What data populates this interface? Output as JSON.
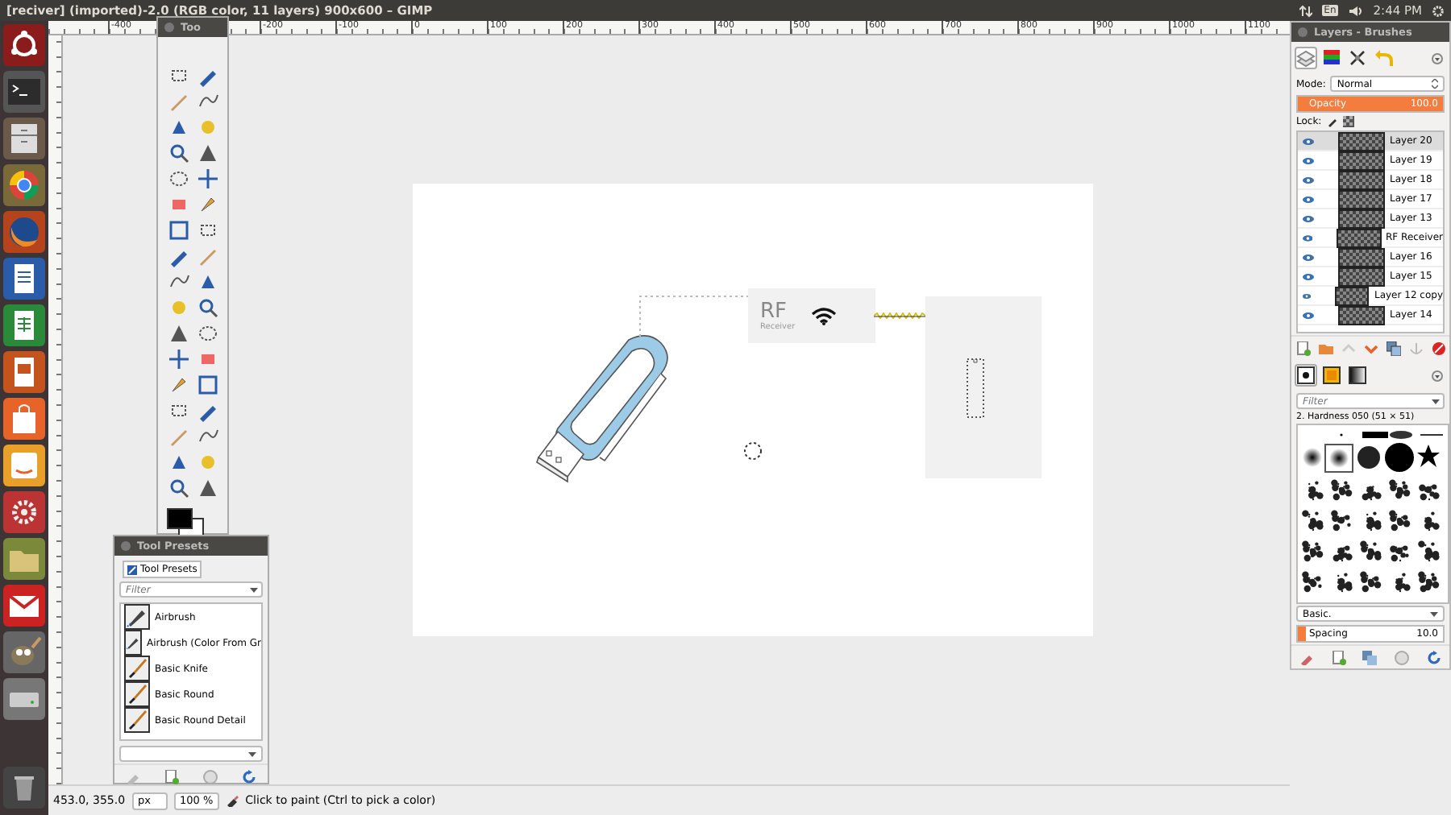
{
  "window": {
    "title": "[reciver] (imported)-2.0 (RGB color, 11 layers) 900x600 – GIMP"
  },
  "tray": {
    "keyboard": "En",
    "clock": "2:44 PM"
  },
  "ruler": {
    "labels": [
      "-400",
      "-200",
      "-100",
      "0",
      "100",
      "200",
      "300",
      "400",
      "500",
      "600",
      "700",
      "800",
      "900",
      "1000",
      "1100"
    ]
  },
  "toolbox": {
    "title": "Too"
  },
  "tool_presets": {
    "title": "Tool Presets",
    "tab": "Tool Presets",
    "filter": {
      "placeholder": "Filter"
    },
    "items": [
      {
        "name": "Airbrush",
        "kind": "airbrush"
      },
      {
        "name": "Airbrush (Color From Gr",
        "kind": "airbrush"
      },
      {
        "name": "Basic Knife",
        "kind": "brush"
      },
      {
        "name": "Basic Round",
        "kind": "brush"
      },
      {
        "name": "Basic Round Detail",
        "kind": "brush"
      }
    ]
  },
  "layers_dock": {
    "title": "Layers - Brushes",
    "tabs": [
      {
        "kind": "layers",
        "selected": true
      },
      {
        "kind": "channels",
        "selected": false
      },
      {
        "kind": "paths",
        "selected": false
      },
      {
        "kind": "undo",
        "selected": false
      }
    ],
    "mode_label": "Mode:",
    "mode": "Normal",
    "opacity": {
      "label": "Opacity",
      "value": "100.0",
      "level": 1
    },
    "lock_label": "Lock:",
    "layers": [
      {
        "name": "Layer 20",
        "visible": true,
        "selected": true
      },
      {
        "name": "Layer 19",
        "visible": true,
        "selected": false
      },
      {
        "name": "Layer 18",
        "visible": true,
        "selected": false
      },
      {
        "name": "Layer 17",
        "visible": true,
        "selected": false
      },
      {
        "name": "Layer 13",
        "visible": true,
        "selected": false
      },
      {
        "name": "RF Receiver",
        "visible": true,
        "selected": false
      },
      {
        "name": "Layer 16",
        "visible": true,
        "selected": false
      },
      {
        "name": "Layer 15",
        "visible": true,
        "selected": false
      },
      {
        "name": "Layer 12 copy",
        "visible": true,
        "selected": false
      },
      {
        "name": "Layer 14",
        "visible": true,
        "selected": false
      }
    ]
  },
  "brushes": {
    "tabs": [
      {
        "kind": "brushes",
        "selected": true
      },
      {
        "kind": "patterns",
        "selected": false
      },
      {
        "kind": "gradients",
        "selected": false
      }
    ],
    "filter": {
      "placeholder": "Filter"
    },
    "brush_name": "2. Hardness 050 (51 × 51)",
    "preset": "Basic.",
    "spacing": {
      "label": "Spacing",
      "value": "10.0",
      "level": 0.05
    }
  },
  "canvas": {
    "rf_label": "RF",
    "rf_sublabel": "Receiver"
  },
  "status_bar": {
    "coordinates": "453.0, 355.0",
    "unit": "px",
    "zoom": "100 %",
    "message": "Click to paint (Ctrl to pick a color)"
  }
}
